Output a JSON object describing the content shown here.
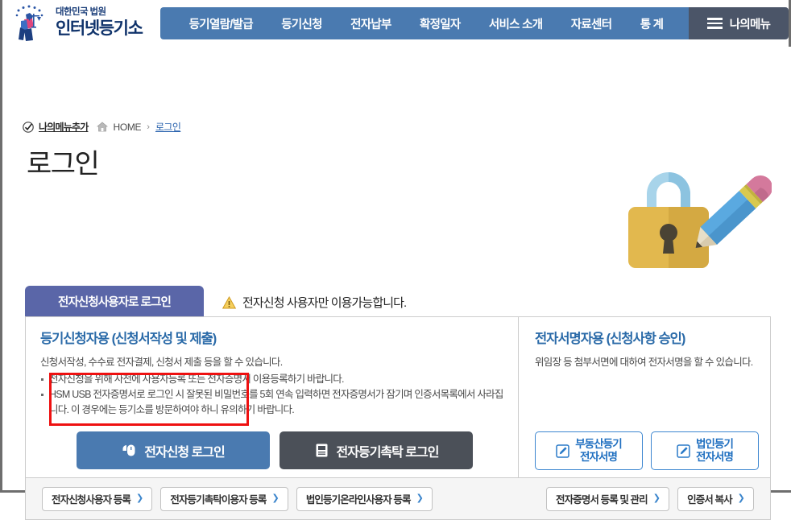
{
  "header": {
    "logo": {
      "court_line": "대한민국 법원",
      "site_name": "인터넷등기소",
      "emblem_name": "scales-of-justice-emblem"
    },
    "nav_items": [
      {
        "label": "등기열람/발급"
      },
      {
        "label": "등기신청"
      },
      {
        "label": "전자납부"
      },
      {
        "label": "확정일자"
      },
      {
        "label": "서비스 소개"
      },
      {
        "label": "자료센터"
      },
      {
        "label": "통 계"
      }
    ],
    "my_menu": {
      "label": "나의메뉴",
      "icon": "hamburger-icon"
    },
    "colors": {
      "nav_blue": "#4a7ab0",
      "my_menu_gray": "#4b5568",
      "logo_navy": "#10336b"
    }
  },
  "breadcrumb": {
    "add_my_menu": "나의메뉴추가",
    "home": "HOME",
    "separator": "›",
    "current": "로그인"
  },
  "page": {
    "title": "로그인",
    "illustration": "padlock-with-pencil-illustration"
  },
  "tabs": {
    "active": {
      "label": "전자신청사용자로 로그인"
    },
    "warning": {
      "icon": "warning-triangle-icon",
      "text": "전자신청 사용자만 이용가능합니다."
    }
  },
  "panels": {
    "left": {
      "heading": "등기신청자용 (신청서작성 및 제출)",
      "description": "신청서작성, 수수료 전자결제, 신청서 제출 등을 할 수 있습니다.",
      "bullets": [
        "전자신청을 위해 사전에 사용자등록 또는 전자증명서 이용등록하기 바랍니다.",
        "HSM USB 전자증명서로 로그인 시 잘못된 비밀번호를 5회 연속 입력하면 전자증명서가 잠기며 인증서목록에서 사라집니다. 이 경우에는 등기소를 방문하여야 하니 유의하기 바랍니다."
      ],
      "buttons": [
        {
          "label": "전자신청 로그인",
          "icon": "mouse-lock-icon",
          "style": "primary-blue"
        },
        {
          "label": "전자등기촉탁 로그인",
          "icon": "document-icon",
          "style": "primary-dark"
        }
      ]
    },
    "right": {
      "heading": "전자서명자용 (신청사항 승인)",
      "description": "위임장 등 첨부서면에 대하여 전자서명을 할 수 있습니다.",
      "buttons": [
        {
          "line1": "부동산등기",
          "line2": "전자서명",
          "icon": "pencil-square-icon"
        },
        {
          "line1": "법인등기",
          "line2": "전자서명",
          "icon": "pencil-square-icon"
        }
      ]
    }
  },
  "footer": {
    "left_buttons": [
      {
        "label": "전자신청사용자 등록",
        "chevron": "❯"
      },
      {
        "label": "전자등기촉탁이용자 등록",
        "chevron": "❯"
      },
      {
        "label": "법인등기온라인사용자 등록",
        "chevron": "❯"
      }
    ],
    "right_buttons": [
      {
        "label": "전자증명서 등록 및 관리",
        "chevron": "❯"
      },
      {
        "label": "인증서 복사",
        "chevron": "❯"
      }
    ]
  },
  "annotation": {
    "highlight_color": "#ee1111",
    "target": "전자신청 로그인"
  }
}
